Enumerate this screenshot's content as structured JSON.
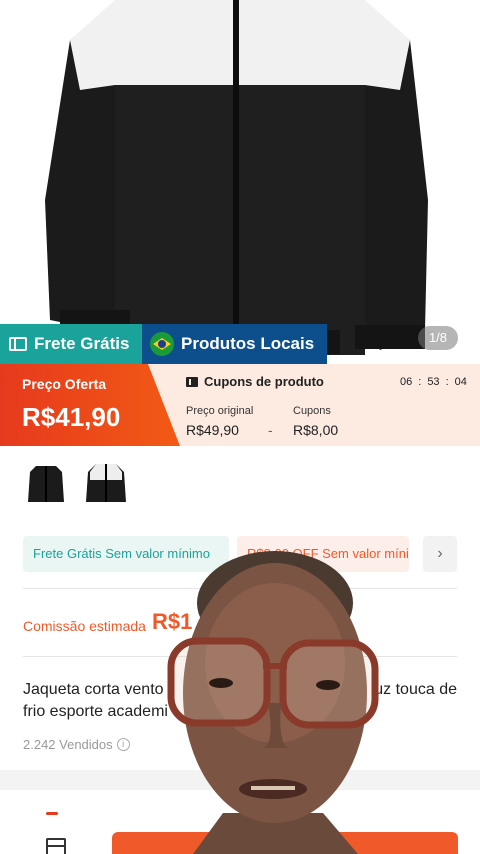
{
  "image_counter": "1/8",
  "tags": {
    "free_shipping": "Frete Grátis",
    "local_products": "Produtos Locais"
  },
  "price": {
    "offer_label": "Preço Oferta",
    "offer_value": "R$41,90",
    "coupons_title": "Cupons de produto",
    "timer": {
      "h": "06",
      "m": "53",
      "s": "04",
      "sep": ":"
    },
    "original_label": "Preço original",
    "original_value": "R$49,90",
    "minus": "-",
    "coupons_label": "Cupons",
    "coupons_value": "R$8,00"
  },
  "chips": {
    "free_shipping": "Frete Grátis Sem valor mínimo",
    "discount": "R$8,00 OFF Sem valor mínimo",
    "more": "›"
  },
  "commission": {
    "label": "Comissão estimada",
    "value": "R$1"
  },
  "product": {
    "title": "Jaqueta corta vento ... uz touca de frio esporte academi...",
    "title_line1_left": "Jaqueta corta vento",
    "title_line1_right": "uz touca de",
    "title_line2": "frio esporte academi",
    "sold": "2.242 Vendidos",
    "info_glyph": "i"
  },
  "colors": {
    "accent": "#f05a2a",
    "teal": "#1aa39a",
    "navy": "#0d4f8d"
  }
}
